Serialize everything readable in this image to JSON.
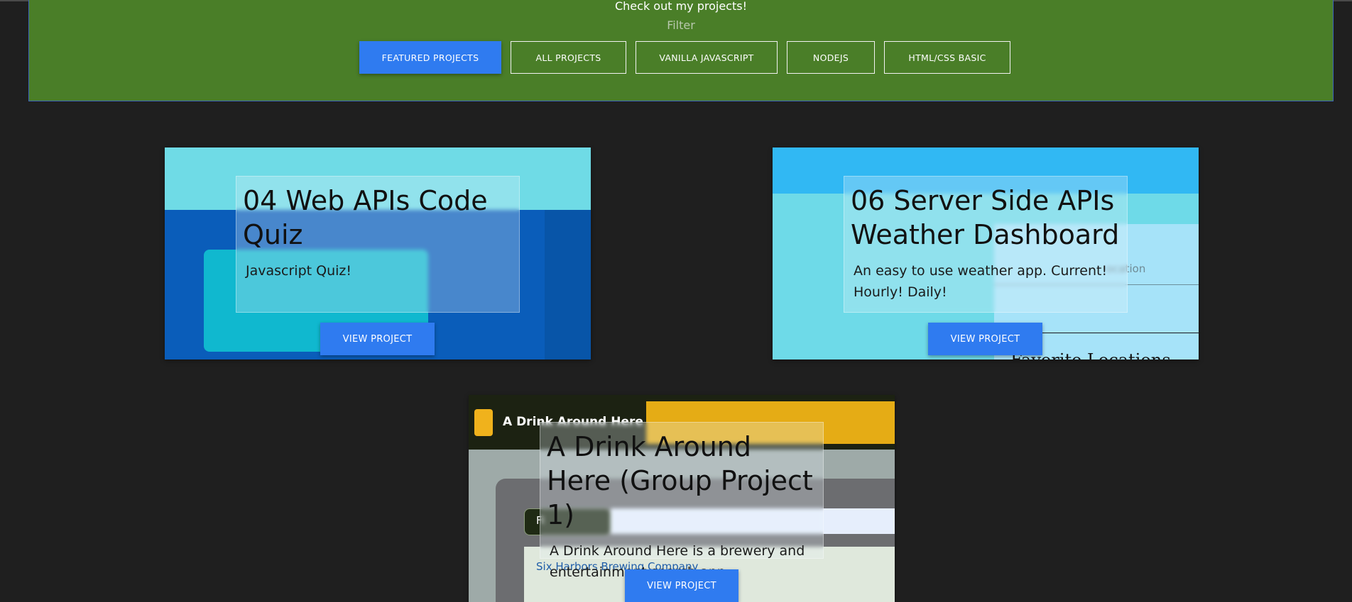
{
  "header": {
    "headline": "Check out my projects!",
    "filter_label": "Filter",
    "filters": [
      {
        "label": "FEATURED PROJECTS",
        "active": true
      },
      {
        "label": "ALL PROJECTS",
        "active": false
      },
      {
        "label": "VANILLA JAVASCRIPT",
        "active": false
      },
      {
        "label": "NODEJS",
        "active": false
      },
      {
        "label": "HTML/CSS BASIC",
        "active": false
      }
    ]
  },
  "projects": [
    {
      "title": "04 Web APIs Code Quiz",
      "description": "Javascript Quiz!",
      "button": "VIEW PROJECT"
    },
    {
      "title": "06 Server Side APIs Weather Dashboard",
      "description": "An easy to use weather app. Current! Hourly! Daily!",
      "button": "VIEW PROJECT",
      "screenshot_text": {
        "location": "ocation",
        "favorite": "Favorite Locations"
      }
    },
    {
      "title": "A Drink Around Here (Group Project 1)",
      "description": "A Drink Around Here is a brewery and entertainment search app.",
      "button": "VIEW PROJECT",
      "screenshot_text": {
        "brand": "A Drink Around Here",
        "pill": "Fi",
        "brewery": "Six Harbors Brewing Company"
      }
    }
  ],
  "colors": {
    "background": "#1f1f1f",
    "header_green": "#4a7e28",
    "accent_blue": "#2f7bf0"
  }
}
